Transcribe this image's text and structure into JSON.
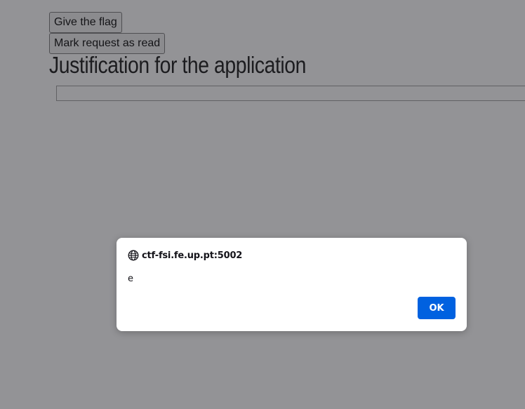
{
  "page": {
    "buttons": {
      "give_flag": "Give the flag",
      "mark_read": "Mark request as read"
    },
    "heading": "Justification for the application"
  },
  "alert": {
    "origin": "ctf-fsi.fe.up.pt:5002",
    "message": "e",
    "ok_label": "OK"
  },
  "colors": {
    "overlay": "#28282d80",
    "ok_button": "#0061e0"
  }
}
